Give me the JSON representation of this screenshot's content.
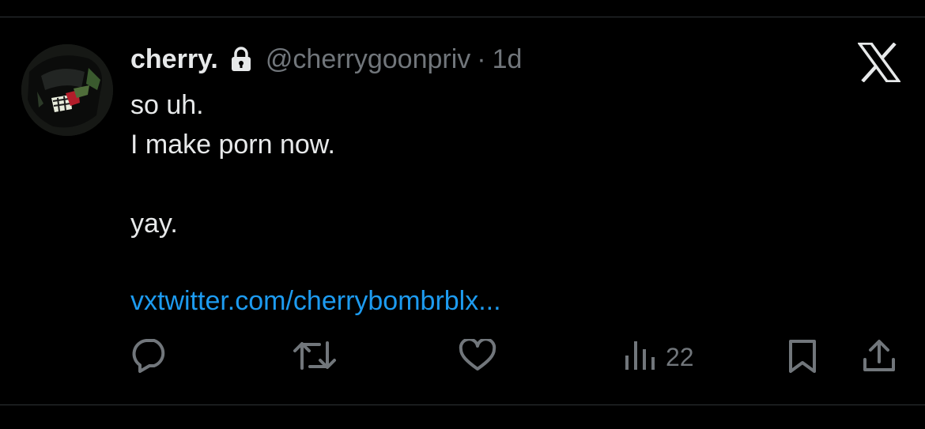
{
  "tweet": {
    "display_name": "cherry.",
    "handle": "@cherrygoonpriv",
    "separator": "·",
    "timestamp": "1d",
    "text_lines": [
      "so uh.",
      "I make porn now.",
      "",
      "yay."
    ],
    "link_text": "vxtwitter.com/cherrybombrblx...",
    "views_count": "22"
  },
  "icons": {
    "lock": "lock-icon",
    "logo": "x-logo-icon",
    "reply": "reply-icon",
    "retweet": "retweet-icon",
    "like": "heart-icon",
    "views": "views-icon",
    "bookmark": "bookmark-icon",
    "share": "share-icon"
  },
  "colors": {
    "background": "#000000",
    "primary_text": "#e7e9ea",
    "secondary_text": "#71767b",
    "link": "#1d9bf0",
    "divider": "#2f3336"
  }
}
